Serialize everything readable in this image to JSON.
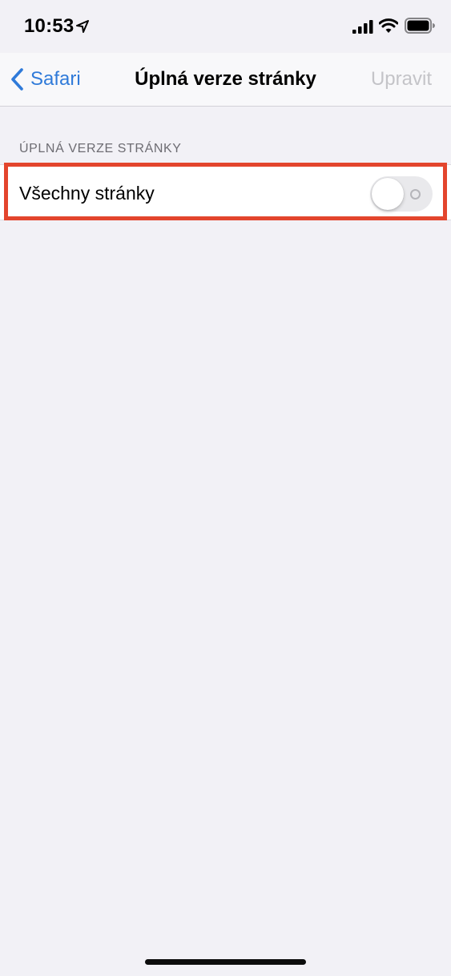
{
  "status_bar": {
    "time": "10:53",
    "icons": [
      "location-arrow-icon",
      "cellular-signal-icon",
      "wifi-icon",
      "battery-icon"
    ]
  },
  "nav": {
    "back_label": "Safari",
    "title": "Úplná verze stránky",
    "edit_label": "Upravit",
    "edit_enabled": false
  },
  "section": {
    "header": "ÚPLNÁ VERZE STRÁNKY",
    "rows": [
      {
        "label": "Všechny stránky",
        "toggle_on": false
      }
    ]
  },
  "colors": {
    "accent": "#2f7ad9",
    "background": "#f2f1f6",
    "disabled_text": "#c4c4c8",
    "highlight": "#e3452d",
    "toggle_off_track": "#e9e9ec"
  }
}
